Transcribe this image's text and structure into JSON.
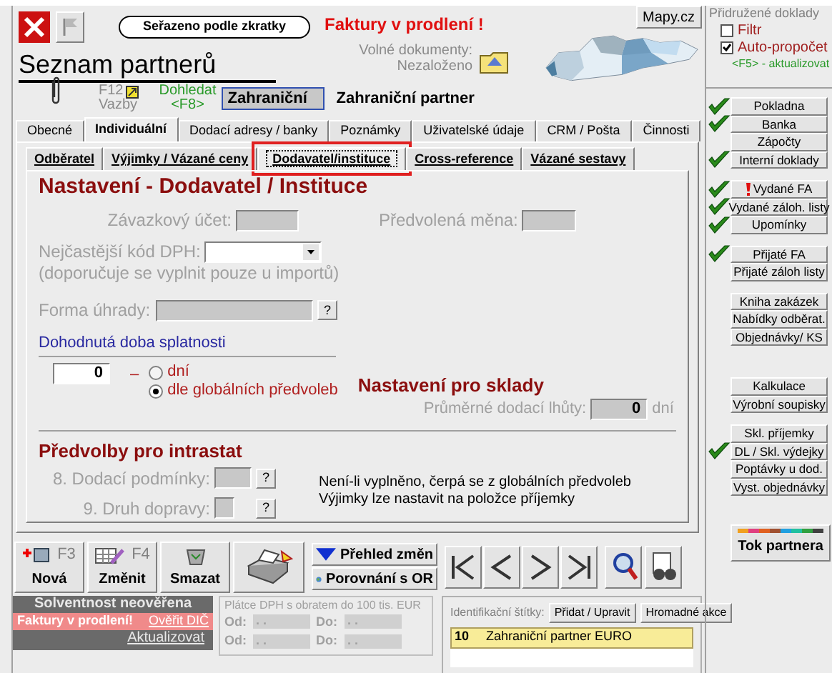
{
  "header": {
    "sort_hint": "Seřazeno podle zkratky",
    "alert": "Faktury v prodlení !",
    "title": "Seznam partnerů",
    "map_button": "Mapy.cz",
    "free_docs_label": "Volné dokumenty:",
    "free_docs_value": "Nezaloženo"
  },
  "search_bar": {
    "shortcut": "F12",
    "links_label": "Vazby",
    "find_label": "Dohledat",
    "find_shortcut": "<F8>",
    "value": "Zahraniční",
    "partner_name": "Zahraniční partner"
  },
  "tabs": [
    {
      "label": "Obecné",
      "selected": false
    },
    {
      "label": "Individuální",
      "selected": true
    },
    {
      "label": "Dodací adresy / banky",
      "selected": false
    },
    {
      "label": "Poznámky",
      "selected": false
    },
    {
      "label": "Uživatelské údaje",
      "selected": false
    },
    {
      "label": "CRM / Pošta",
      "selected": false
    },
    {
      "label": "Činnosti",
      "selected": false
    }
  ],
  "subtabs": [
    {
      "label": "Odběratel",
      "selected": false,
      "highlighted": false
    },
    {
      "label": "Výjimky / Vázané ceny",
      "selected": false,
      "highlighted": false
    },
    {
      "label": "Dodavatel/instituce",
      "selected": true,
      "highlighted": true
    },
    {
      "label": "Cross-reference",
      "selected": false,
      "highlighted": false
    },
    {
      "label": "Vázané sestavy",
      "selected": false,
      "highlighted": false
    }
  ],
  "supplier": {
    "heading": "Nastavení - Dodavatel / Instituce",
    "account": {
      "label": "Závazkový účet:",
      "disabled": true
    },
    "currency": {
      "label": "Předvolená měna:",
      "disabled": true
    },
    "vat_code": {
      "label": "Nejčastější kód DPH:",
      "note": "(doporučuje se vyplnit pouze u importů)",
      "disabled": true
    },
    "payment": {
      "label": "Forma úhrady:",
      "help": "?",
      "disabled": true
    },
    "due": {
      "heading": "Dohodnutá doba splatnosti",
      "value": "0",
      "dash": "–",
      "options": [
        {
          "label": "dní",
          "selected": false
        },
        {
          "label": "dle globálních předvoleb",
          "selected": true
        }
      ]
    }
  },
  "warehouse": {
    "heading": "Nastavení pro sklady",
    "label": "Průměrné dodací lhůty:",
    "value": "0",
    "unit": "dní"
  },
  "intrastat": {
    "heading": "Předvolby pro intrastat",
    "fields": [
      {
        "label": "8. Dodací podmínky:",
        "help": "?"
      },
      {
        "label": "9. Druh dopravy:",
        "help": "?"
      }
    ],
    "note": [
      "Není-li vyplněno, čerpá se z globálních předvoleb",
      "Výjimky lze nastavit na položce příjemky"
    ]
  },
  "actions": [
    {
      "label": "Nová",
      "shortcut": "F3",
      "kind": "new"
    },
    {
      "label": "Změnit",
      "shortcut": "F4",
      "kind": "edit"
    },
    {
      "label": "Smazat",
      "kind": "delete"
    }
  ],
  "compare": [
    "Přehled změn",
    "Porovnání s OR"
  ],
  "status": {
    "title": "Solventnost neověřena",
    "alert": "Faktury v prodlení!",
    "verify_link": "Ověřit DIČ",
    "refresh_link": "Aktualizovat"
  },
  "vat_payer": {
    "title": "Plátce DPH s obratem do 100 tis. EUR",
    "rows": [
      {
        "from_label": "Od:",
        "from": ". .",
        "to_label": "Do:",
        "to": ". ."
      },
      {
        "from_label": "Od:",
        "from": ". .",
        "to_label": "Do:",
        "to": ". ."
      }
    ]
  },
  "id_labels": {
    "title": "Identifikační štítky:",
    "buttons": [
      "Přidat / Upravit",
      "Hromadné akce"
    ],
    "rows": [
      {
        "code": "10",
        "name": "Zahraniční partner EURO",
        "selected": true
      }
    ]
  },
  "related": {
    "title": "Přidružené doklady",
    "options": [
      {
        "label": "Filtr",
        "checked": false
      },
      {
        "label": "Auto-propočet",
        "checked": true
      }
    ],
    "hint": "<F5> - aktualizovat",
    "groups": [
      [
        {
          "label": "Pokladna",
          "checked": true,
          "warning": false
        },
        {
          "label": "Banka",
          "checked": true,
          "warning": false
        },
        {
          "label": "Zápočty",
          "checked": false,
          "warning": false
        },
        {
          "label": "Interní doklady",
          "checked": true,
          "warning": false
        }
      ],
      [
        {
          "label": "Vydané FA",
          "checked": true,
          "warning": true
        },
        {
          "label": "Vydané záloh. listy",
          "checked": true,
          "warning": false
        },
        {
          "label": "Upomínky",
          "checked": true,
          "warning": false
        }
      ],
      [
        {
          "label": "Přijaté FA",
          "checked": true,
          "warning": false
        },
        {
          "label": "Přijaté záloh listy",
          "checked": false,
          "warning": false
        }
      ],
      [
        {
          "label": "Kniha zakázek",
          "checked": false,
          "warning": false
        },
        {
          "label": "Nabídky odběrat.",
          "checked": false,
          "warning": false
        },
        {
          "label": "Objednávky/ KS",
          "checked": false,
          "warning": false
        }
      ],
      [
        {
          "label": "Kalkulace",
          "checked": false,
          "warning": false
        },
        {
          "label": "Výrobní soupisky",
          "checked": false,
          "warning": false
        }
      ],
      [
        {
          "label": "Skl. příjemky",
          "checked": false,
          "warning": false
        },
        {
          "label": "DL / Skl. výdejky",
          "checked": true,
          "warning": false
        },
        {
          "label": "Poptávky u dod.",
          "checked": false,
          "warning": false
        },
        {
          "label": "Vyst. objednávky",
          "checked": false,
          "warning": false
        }
      ]
    ],
    "flow_button": "Tok partnera"
  }
}
